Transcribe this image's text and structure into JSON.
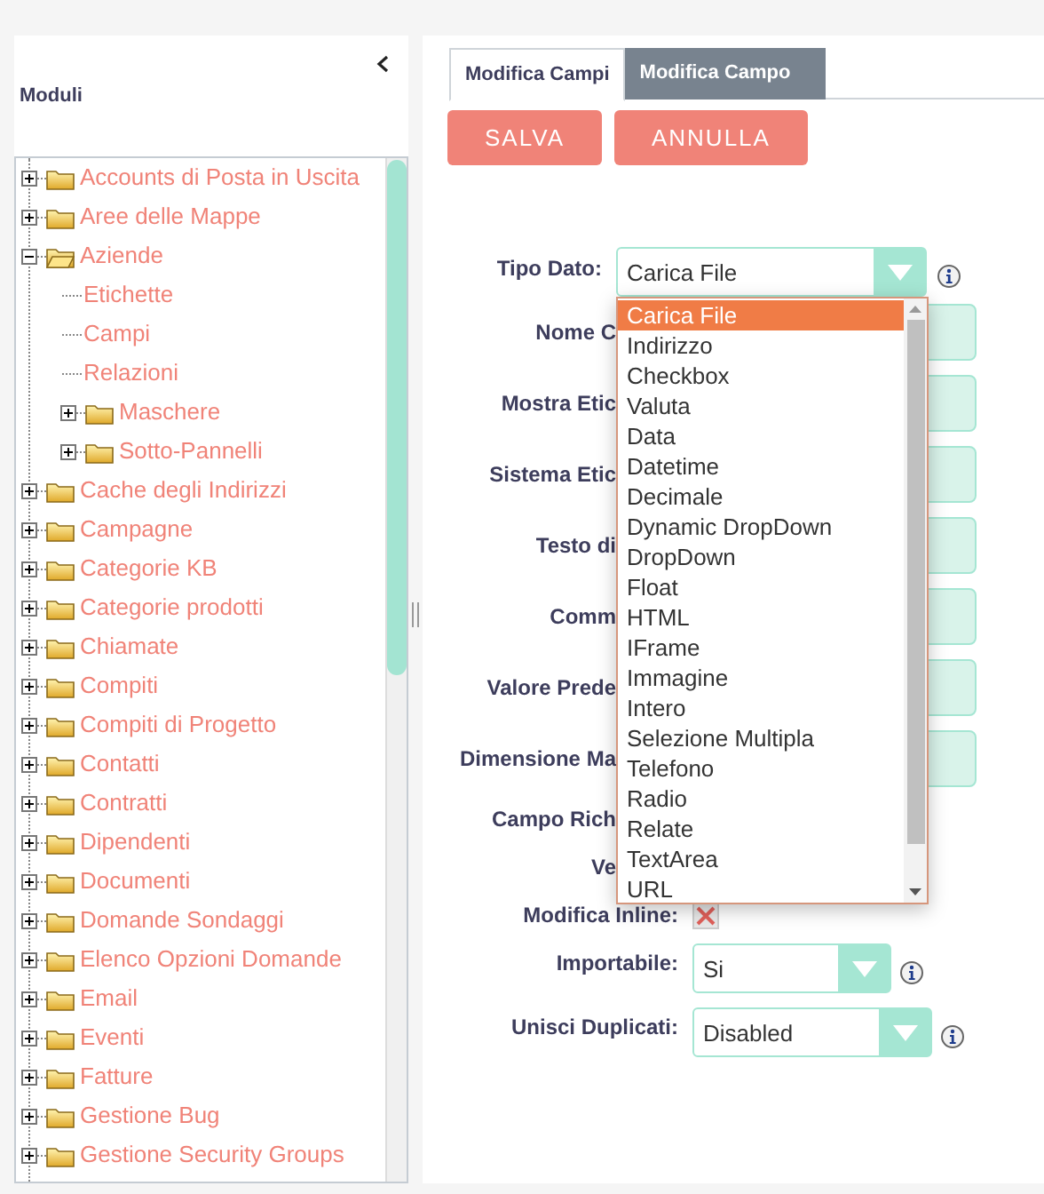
{
  "sidebar": {
    "title": "Moduli",
    "tree": [
      {
        "label": "Accounts di Posta in Uscita",
        "kind": "folder",
        "expanded": false
      },
      {
        "label": "Aree delle Mappe",
        "kind": "folder",
        "expanded": false
      },
      {
        "label": "Aziende",
        "kind": "folder",
        "expanded": true,
        "children": [
          {
            "label": "Etichette",
            "kind": "leaf"
          },
          {
            "label": "Campi",
            "kind": "leaf"
          },
          {
            "label": "Relazioni",
            "kind": "leaf"
          },
          {
            "label": "Maschere",
            "kind": "folder",
            "expanded": false
          },
          {
            "label": "Sotto-Pannelli",
            "kind": "folder",
            "expanded": false
          }
        ]
      },
      {
        "label": "Cache degli Indirizzi",
        "kind": "folder",
        "expanded": false
      },
      {
        "label": "Campagne",
        "kind": "folder",
        "expanded": false
      },
      {
        "label": "Categorie KB",
        "kind": "folder",
        "expanded": false
      },
      {
        "label": "Categorie prodotti",
        "kind": "folder",
        "expanded": false
      },
      {
        "label": "Chiamate",
        "kind": "folder",
        "expanded": false
      },
      {
        "label": "Compiti",
        "kind": "folder",
        "expanded": false
      },
      {
        "label": "Compiti di Progetto",
        "kind": "folder",
        "expanded": false
      },
      {
        "label": "Contatti",
        "kind": "folder",
        "expanded": false
      },
      {
        "label": "Contratti",
        "kind": "folder",
        "expanded": false
      },
      {
        "label": "Dipendenti",
        "kind": "folder",
        "expanded": false
      },
      {
        "label": "Documenti",
        "kind": "folder",
        "expanded": false
      },
      {
        "label": "Domande Sondaggi",
        "kind": "folder",
        "expanded": false
      },
      {
        "label": "Elenco Opzioni Domande",
        "kind": "folder",
        "expanded": false
      },
      {
        "label": "Email",
        "kind": "folder",
        "expanded": false
      },
      {
        "label": "Eventi",
        "kind": "folder",
        "expanded": false
      },
      {
        "label": "Fatture",
        "kind": "folder",
        "expanded": false
      },
      {
        "label": "Gestione Bug",
        "kind": "folder",
        "expanded": false
      },
      {
        "label": "Gestione Security Groups",
        "kind": "folder",
        "expanded": false
      }
    ]
  },
  "tabs": [
    {
      "label": "Modifica Campi",
      "selected": true
    },
    {
      "label": "Modifica Campo",
      "selected": false
    }
  ],
  "buttons": [
    "SALVA",
    "ANNULLA"
  ],
  "form": {
    "type_field": {
      "label": "Tipo Dato:",
      "value": "Carica File",
      "options": [
        {
          "label": "Carica File",
          "selected": true
        },
        {
          "label": "Indirizzo",
          "selected": false
        },
        {
          "label": "Checkbox",
          "selected": false
        },
        {
          "label": "Valuta",
          "selected": false
        },
        {
          "label": "Data",
          "selected": false
        },
        {
          "label": "Datetime",
          "selected": false
        },
        {
          "label": "Decimale",
          "selected": false
        },
        {
          "label": "Dynamic DropDown",
          "selected": false
        },
        {
          "label": "DropDown",
          "selected": false
        },
        {
          "label": "Float",
          "selected": false
        },
        {
          "label": "HTML",
          "selected": false
        },
        {
          "label": "IFrame",
          "selected": false
        },
        {
          "label": "Immagine",
          "selected": false
        },
        {
          "label": "Intero",
          "selected": false
        },
        {
          "label": "Selezione Multipla",
          "selected": false
        },
        {
          "label": "Telefono",
          "selected": false
        },
        {
          "label": "Radio",
          "selected": false
        },
        {
          "label": "Relate",
          "selected": false
        },
        {
          "label": "TextArea",
          "selected": false
        },
        {
          "label": "URL",
          "selected": false
        }
      ]
    },
    "rows": [
      {
        "label": "Nome C",
        "kind": "input"
      },
      {
        "label": "Mostra Etic",
        "kind": "input"
      },
      {
        "label": "Sistema Etic",
        "kind": "input"
      },
      {
        "label": "Testo di",
        "kind": "input"
      },
      {
        "label": "Comm",
        "kind": "input"
      },
      {
        "label": "Valore Prede",
        "kind": "input"
      },
      {
        "label": "Dimensione Ma",
        "kind": "input"
      },
      {
        "label": "Campo Rich",
        "kind": "plain"
      },
      {
        "label": "Ve",
        "kind": "plain"
      },
      {
        "label": "Modifica Inline:",
        "kind": "checkbox",
        "crossed": true
      },
      {
        "label": "Importabile:",
        "kind": "select",
        "value": "Si"
      },
      {
        "label": "Unisci Duplicati:",
        "kind": "select",
        "value": "Disabled"
      }
    ]
  }
}
